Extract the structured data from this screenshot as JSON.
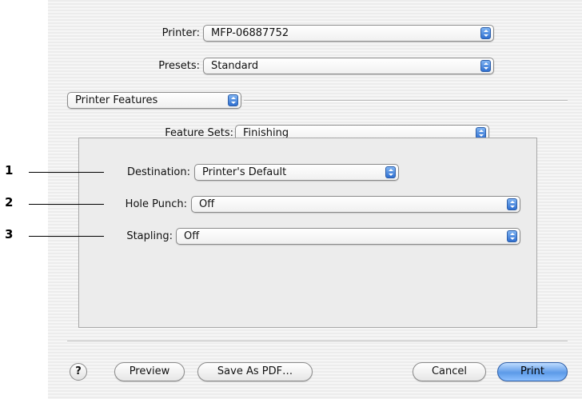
{
  "printer": {
    "label": "Printer:",
    "value": "MFP-06887752"
  },
  "presets": {
    "label": "Presets:",
    "value": "Standard"
  },
  "panel": {
    "value": "Printer Features"
  },
  "feature_sets": {
    "label": "Feature Sets:",
    "value": "Finishing"
  },
  "destination": {
    "label": "Destination:",
    "value": "Printer's Default"
  },
  "hole_punch": {
    "label": "Hole Punch:",
    "value": "Off"
  },
  "stapling": {
    "label": "Stapling:",
    "value": "Off"
  },
  "callouts": [
    "1",
    "2",
    "3"
  ],
  "buttons": {
    "help": "?",
    "preview": "Preview",
    "save_pdf": "Save As PDF…",
    "cancel": "Cancel",
    "print": "Print"
  }
}
